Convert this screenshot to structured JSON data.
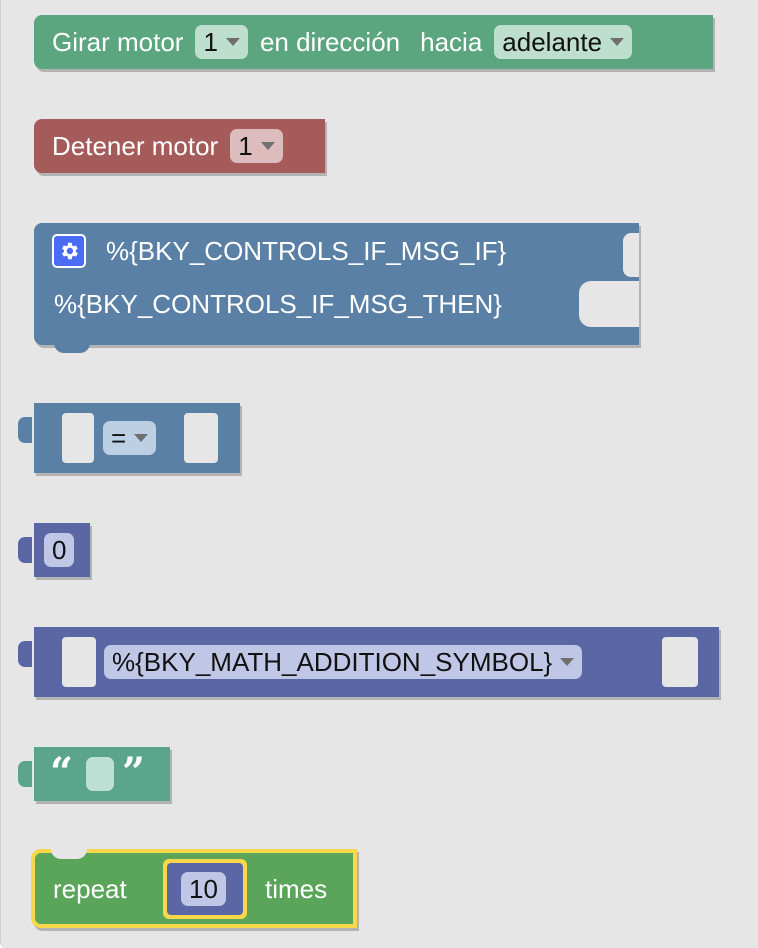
{
  "blocks": {
    "motor_turn": {
      "label_prefix": "Girar motor",
      "motor_value": "1",
      "label_mid": "en dirección",
      "label_dir": "hacia",
      "direction_value": "adelante",
      "color": "#5ba67f"
    },
    "motor_stop": {
      "label": "Detener motor",
      "motor_value": "1",
      "color": "#a65b5b"
    },
    "controls_if": {
      "if_label": "%{BKY_CONTROLS_IF_MSG_IF}",
      "then_label": "%{BKY_CONTROLS_IF_MSG_THEN}",
      "gear_icon": "gear-icon",
      "color": "#5b80a5"
    },
    "logic_compare": {
      "operator": "=",
      "color": "#5b80a5"
    },
    "math_number": {
      "value": "0",
      "color": "#5b67a5"
    },
    "math_arithmetic": {
      "operator": "%{BKY_MATH_ADDITION_SYMBOL}",
      "color": "#5b67a5"
    },
    "text": {
      "open_quote": "“",
      "close_quote": "”",
      "value": "",
      "color": "#5ba58c"
    },
    "repeat": {
      "label_prefix": "repeat",
      "count": "10",
      "label_suffix": "times",
      "color": "#5ba55b",
      "highlight": "#f8d74a"
    }
  }
}
